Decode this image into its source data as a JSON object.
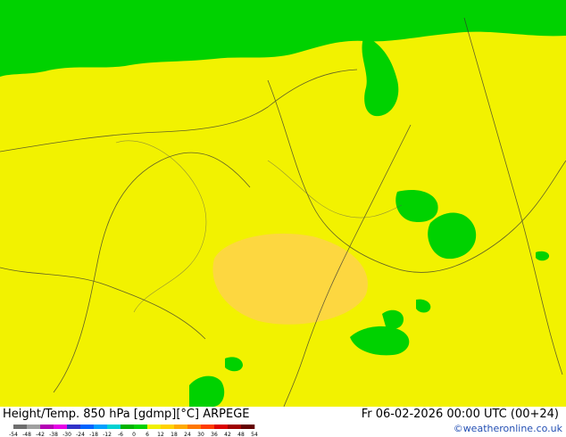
{
  "map": {
    "title_left": "Height/Temp. 850 hPa [gdmp][°C] ARPEGE",
    "title_right": "Fr 06-02-2026 00:00 UTC (00+24)",
    "credit": "©weatheronline.co.uk",
    "colorbar": {
      "tick_labels": [
        "-54",
        "-48",
        "-42",
        "-38",
        "-30",
        "-24",
        "-18",
        "-12",
        "-6",
        "0",
        "6",
        "12",
        "18",
        "24",
        "30",
        "36",
        "42",
        "48",
        "54"
      ],
      "colors": [
        "#6e6e6e",
        "#a0a0a0",
        "#b400b4",
        "#e600e6",
        "#3232c8",
        "#0064ff",
        "#00a0ff",
        "#00d2d2",
        "#00b400",
        "#00d200",
        "#f0f000",
        "#ffd200",
        "#ffaa00",
        "#ff7800",
        "#ff3c00",
        "#dc0000",
        "#a00000",
        "#640000"
      ]
    },
    "fill_colors": {
      "warm": "#f2f200",
      "warmer": "#ffd24b",
      "cold": "#00d200"
    }
  }
}
